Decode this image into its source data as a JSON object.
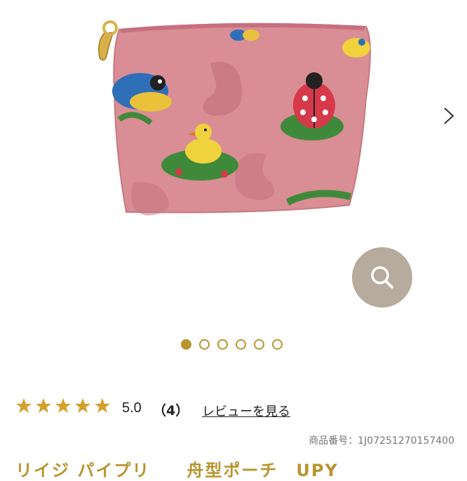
{
  "gallery": {
    "image_alt": "pink tapestry pouch with birds and ladybug",
    "current_index": 1,
    "total_images": 6
  },
  "zoom": {
    "icon": "search-icon"
  },
  "next": {
    "icon": "chevron-right-icon"
  },
  "rating": {
    "stars": 5,
    "score": "5.0",
    "count": "（4）",
    "review_link": "レビューを見る",
    "star_color": "#d4a02b"
  },
  "product": {
    "number": "商品番号：1J07251270157400",
    "title": "リイジ パイプリ　　舟型ポーチ　UPY"
  },
  "colors": {
    "accent": "#b8952f",
    "zoom_bg": "#b6ab9c",
    "pouch_pink": "#d98d95"
  }
}
